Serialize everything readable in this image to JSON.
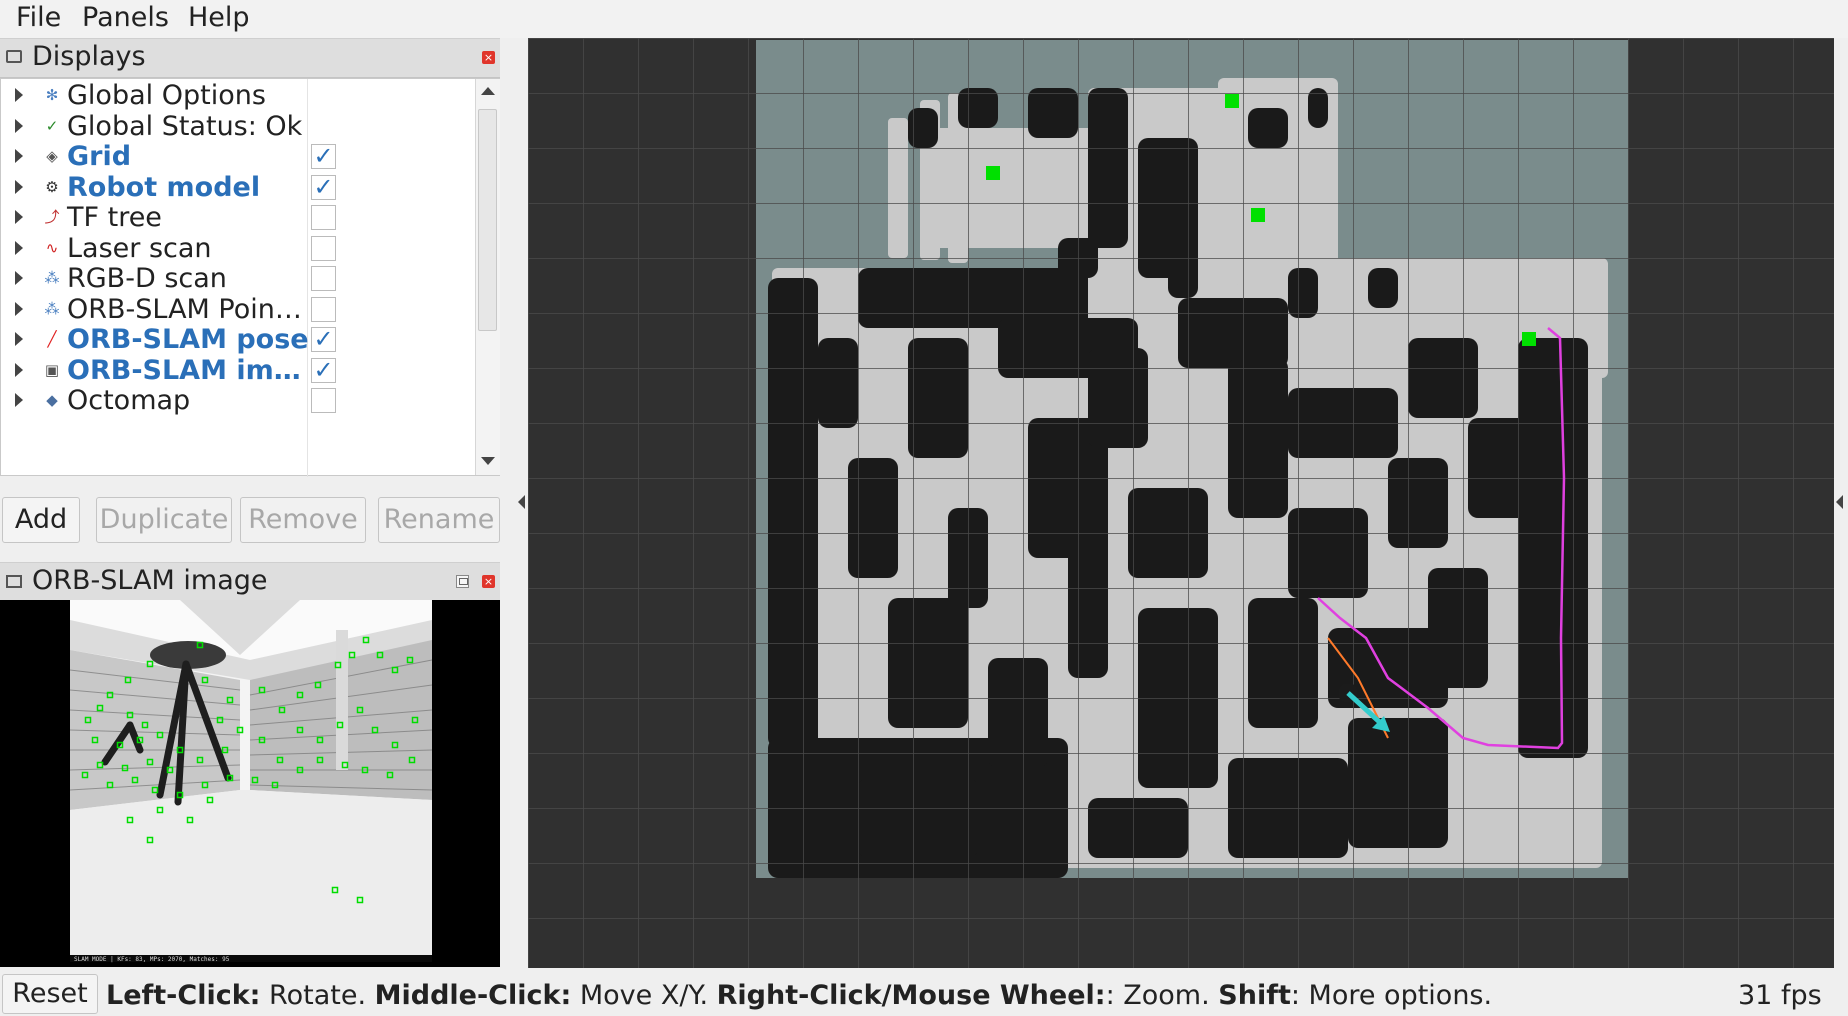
{
  "menubar": {
    "file": "File",
    "panels": "Panels",
    "help": "Help"
  },
  "displays_panel": {
    "title": "Displays",
    "items": [
      {
        "label": "Global Options",
        "icon": "gear-icon",
        "enabled": null,
        "bold": false
      },
      {
        "label": "Global Status: Ok",
        "icon": "check-icon",
        "enabled": null,
        "bold": false
      },
      {
        "label": "Grid",
        "icon": "grid-icon",
        "enabled": true,
        "bold": true
      },
      {
        "label": "Robot model",
        "icon": "robot-icon",
        "enabled": true,
        "bold": true
      },
      {
        "label": "TF tree",
        "icon": "axes-icon",
        "enabled": false,
        "bold": false
      },
      {
        "label": "Laser scan",
        "icon": "laser-icon",
        "enabled": false,
        "bold": false
      },
      {
        "label": "RGB-D scan",
        "icon": "pointcloud-icon",
        "enabled": false,
        "bold": false
      },
      {
        "label": "ORB-SLAM Poin…",
        "icon": "pointcloud-icon",
        "enabled": false,
        "bold": false
      },
      {
        "label": "ORB-SLAM pose",
        "icon": "pose-arrow-icon",
        "enabled": true,
        "bold": true
      },
      {
        "label": "ORB-SLAM im…",
        "icon": "image-icon",
        "enabled": true,
        "bold": true
      },
      {
        "label": "Octomap",
        "icon": "octomap-icon",
        "enabled": false,
        "bold": false
      }
    ],
    "buttons": {
      "add": "Add",
      "duplicate": "Duplicate",
      "remove": "Remove",
      "rename": "Rename"
    }
  },
  "image_panel": {
    "title": "ORB-SLAM image",
    "footer_text": "SLAM MODE | KFs: 83, MPs: 2070, Matches: 95"
  },
  "statusbar": {
    "reset": "Reset",
    "hint_left_click": "Left-Click:",
    "hint_rotate": " Rotate. ",
    "hint_middle_click": "Middle-Click:",
    "hint_move": " Move X/Y. ",
    "hint_right_click": "Right-Click/Mouse Wheel:",
    "hint_zoom": ": Zoom. ",
    "hint_shift": "Shift",
    "hint_more": ": More options.",
    "fps": "31 fps"
  },
  "colors": {
    "enabled_label": "#2a6fb8",
    "map_free": "#c9c9c9",
    "map_occupied": "#1a1a1a",
    "map_unknown": "#7a8c8c",
    "trajectory": "#e040e0",
    "keyframe_marker": "#00e000",
    "pose_arrow": "#33cccc"
  }
}
